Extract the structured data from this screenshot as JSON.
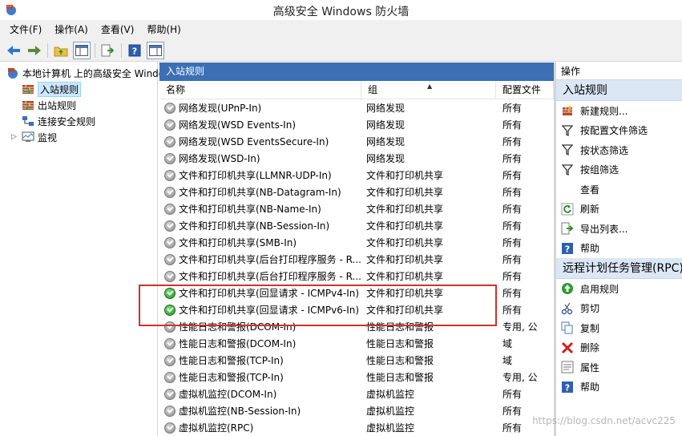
{
  "window": {
    "title": "高级安全 Windows 防火墙"
  },
  "menu": [
    "文件(F)",
    "操作(A)",
    "查看(V)",
    "帮助(H)"
  ],
  "tree": {
    "root": "本地计算机 上的高级安全 Windows",
    "items": [
      "入站规则",
      "出站规则",
      "连接安全规则",
      "监视"
    ]
  },
  "main": {
    "header": "入站规则",
    "columns": {
      "name": "名称",
      "group": "组",
      "profile": "配置文件"
    },
    "rows": [
      {
        "name": "网络发现(UPnP-In)",
        "group": "网络发现",
        "profile": "所有",
        "enabled": false
      },
      {
        "name": "网络发现(WSD Events-In)",
        "group": "网络发现",
        "profile": "所有",
        "enabled": false
      },
      {
        "name": "网络发现(WSD EventsSecure-In)",
        "group": "网络发现",
        "profile": "所有",
        "enabled": false
      },
      {
        "name": "网络发现(WSD-In)",
        "group": "网络发现",
        "profile": "所有",
        "enabled": false
      },
      {
        "name": "文件和打印机共享(LLMNR-UDP-In)",
        "group": "文件和打印机共享",
        "profile": "所有",
        "enabled": false
      },
      {
        "name": "文件和打印机共享(NB-Datagram-In)",
        "group": "文件和打印机共享",
        "profile": "所有",
        "enabled": false
      },
      {
        "name": "文件和打印机共享(NB-Name-In)",
        "group": "文件和打印机共享",
        "profile": "所有",
        "enabled": false
      },
      {
        "name": "文件和打印机共享(NB-Session-In)",
        "group": "文件和打印机共享",
        "profile": "所有",
        "enabled": false
      },
      {
        "name": "文件和打印机共享(SMB-In)",
        "group": "文件和打印机共享",
        "profile": "所有",
        "enabled": false
      },
      {
        "name": "文件和打印机共享(后台打印程序服务 - R...",
        "group": "文件和打印机共享",
        "profile": "所有",
        "enabled": false
      },
      {
        "name": "文件和打印机共享(后台打印程序服务 - R...",
        "group": "文件和打印机共享",
        "profile": "所有",
        "enabled": false
      },
      {
        "name": "文件和打印机共享(回显请求 - ICMPv4-In)",
        "group": "文件和打印机共享",
        "profile": "所有",
        "enabled": true
      },
      {
        "name": "文件和打印机共享(回显请求 - ICMPv6-In)",
        "group": "文件和打印机共享",
        "profile": "所有",
        "enabled": true
      },
      {
        "name": "性能日志和警报(DCOM-In)",
        "group": "性能日志和警报",
        "profile": "专用, 公",
        "enabled": false
      },
      {
        "name": "性能日志和警报(DCOM-In)",
        "group": "性能日志和警报",
        "profile": "域",
        "enabled": false
      },
      {
        "name": "性能日志和警报(TCP-In)",
        "group": "性能日志和警报",
        "profile": "域",
        "enabled": false
      },
      {
        "name": "性能日志和警报(TCP-In)",
        "group": "性能日志和警报",
        "profile": "专用, 公",
        "enabled": false
      },
      {
        "name": "虚拟机监控(DCOM-In)",
        "group": "虚拟机监控",
        "profile": "所有",
        "enabled": false
      },
      {
        "name": "虚拟机监控(NB-Session-In)",
        "group": "虚拟机监控",
        "profile": "所有",
        "enabled": false
      },
      {
        "name": "虚拟机监控(RPC)",
        "group": "虚拟机监控",
        "profile": "所有",
        "enabled": false
      }
    ]
  },
  "actions": {
    "header": "操作",
    "section1": {
      "title": "入站规则",
      "items": [
        {
          "label": "新建规则...",
          "icon": "new-rule-icon"
        },
        {
          "label": "按配置文件筛选",
          "icon": "filter-icon"
        },
        {
          "label": "按状态筛选",
          "icon": "filter-icon"
        },
        {
          "label": "按组筛选",
          "icon": "filter-icon"
        },
        {
          "label": "查看",
          "icon": "none"
        },
        {
          "label": "刷新",
          "icon": "refresh-icon"
        },
        {
          "label": "导出列表...",
          "icon": "export-icon"
        },
        {
          "label": "帮助",
          "icon": "help-icon"
        }
      ]
    },
    "section2": {
      "title": "远程计划任务管理(RPC)",
      "items": [
        {
          "label": "启用规则",
          "icon": "enable-icon"
        },
        {
          "label": "剪切",
          "icon": "cut-icon"
        },
        {
          "label": "复制",
          "icon": "copy-icon"
        },
        {
          "label": "删除",
          "icon": "delete-icon"
        },
        {
          "label": "属性",
          "icon": "properties-icon"
        },
        {
          "label": "帮助",
          "icon": "help-icon"
        }
      ]
    }
  },
  "watermark": "https://blog.csdn.net/acvc225"
}
